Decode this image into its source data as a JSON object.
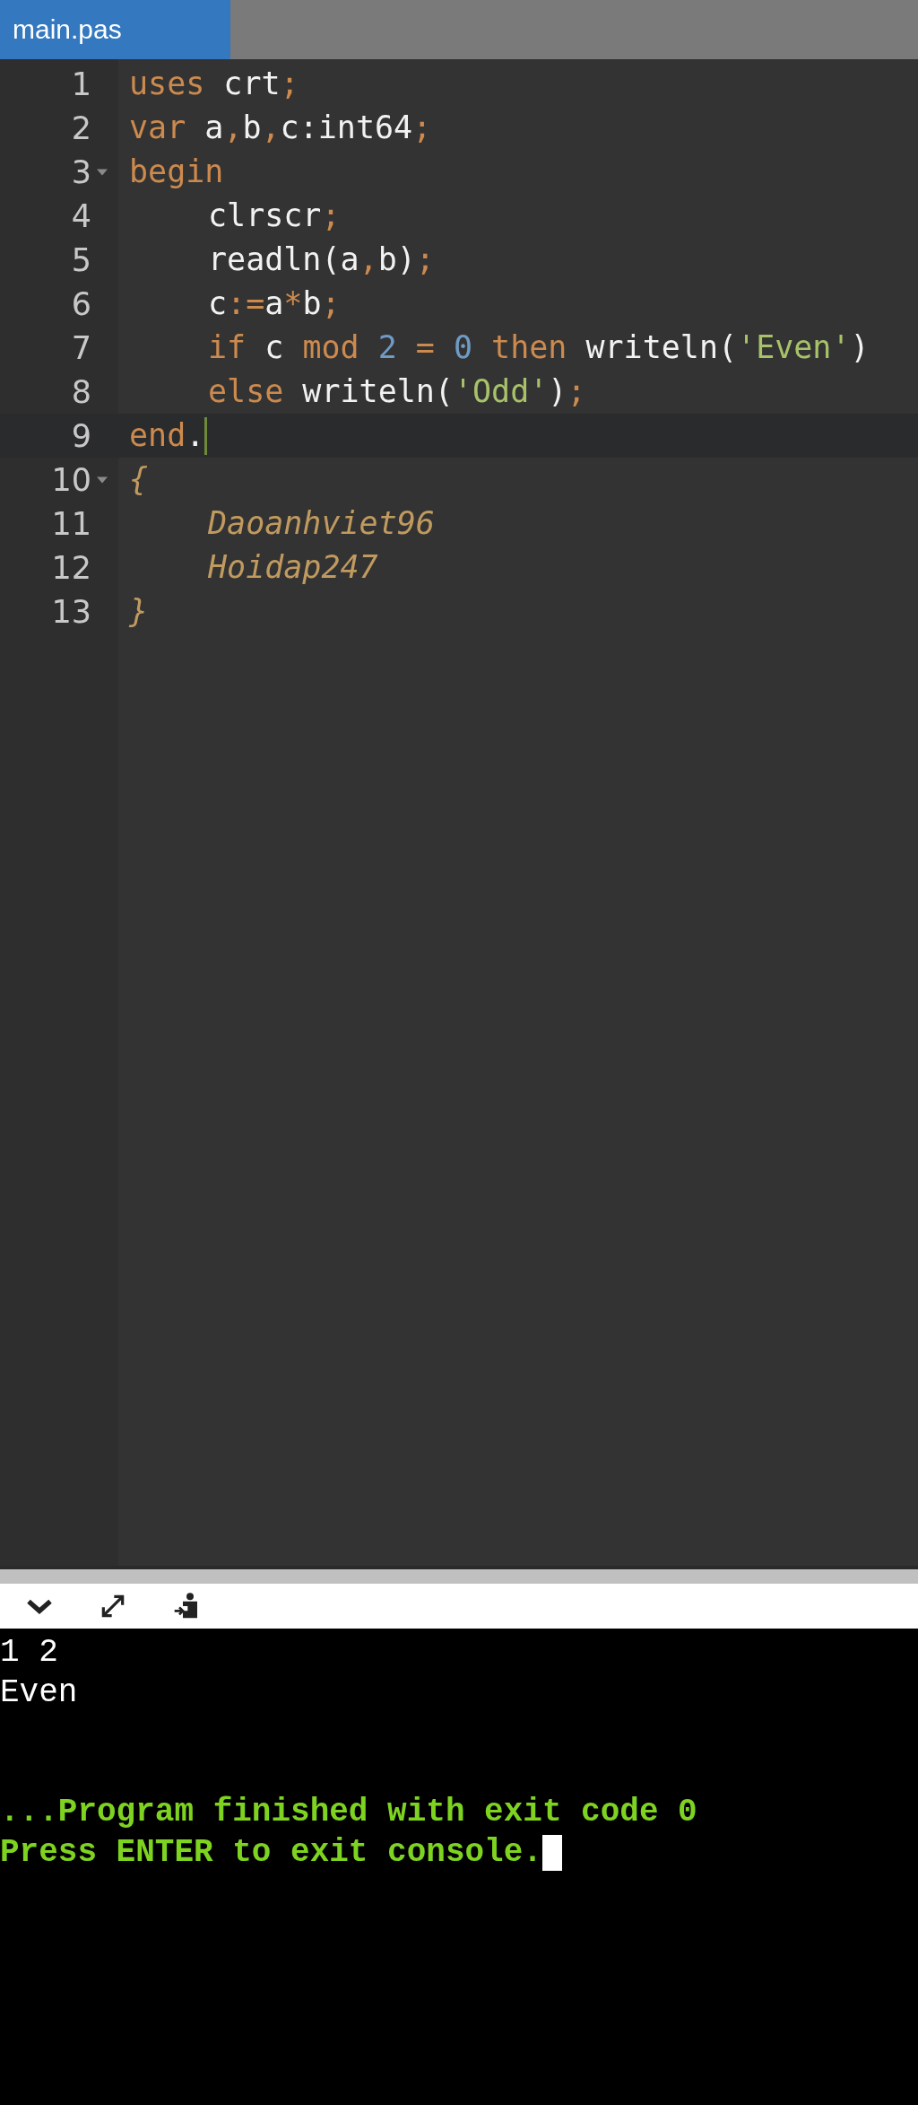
{
  "tabs": [
    {
      "label": "main.pas",
      "selected": true
    }
  ],
  "editor": {
    "lines": [
      {
        "number": "1",
        "foldable": false,
        "active": false,
        "tokens": [
          {
            "text": "uses",
            "kind": "keyword"
          },
          {
            "text": " crt",
            "kind": "ident"
          },
          {
            "text": ";",
            "kind": "punct"
          }
        ]
      },
      {
        "number": "2",
        "foldable": false,
        "active": false,
        "tokens": [
          {
            "text": "var",
            "kind": "keyword"
          },
          {
            "text": " a",
            "kind": "ident"
          },
          {
            "text": ",",
            "kind": "punct"
          },
          {
            "text": "b",
            "kind": "ident"
          },
          {
            "text": ",",
            "kind": "punct"
          },
          {
            "text": "c:int64",
            "kind": "ident"
          },
          {
            "text": ";",
            "kind": "punct"
          }
        ]
      },
      {
        "number": "3",
        "foldable": true,
        "active": false,
        "tokens": [
          {
            "text": "begin",
            "kind": "keyword"
          }
        ],
        "children": [
          {
            "number": "4",
            "foldable": false,
            "active": false,
            "tokens": [
              {
                "text": "clrscr",
                "kind": "ident"
              },
              {
                "text": ";",
                "kind": "punct"
              }
            ]
          },
          {
            "number": "5",
            "foldable": false,
            "active": false,
            "tokens": [
              {
                "text": "readln(a",
                "kind": "ident"
              },
              {
                "text": ",",
                "kind": "punct"
              },
              {
                "text": "b)",
                "kind": "ident"
              },
              {
                "text": ";",
                "kind": "punct"
              }
            ]
          },
          {
            "number": "6",
            "foldable": false,
            "active": false,
            "tokens": [
              {
                "text": "c",
                "kind": "ident"
              },
              {
                "text": ":=",
                "kind": "punct"
              },
              {
                "text": "a",
                "kind": "ident"
              },
              {
                "text": "*",
                "kind": "punct"
              },
              {
                "text": "b",
                "kind": "ident"
              },
              {
                "text": ";",
                "kind": "punct"
              }
            ]
          },
          {
            "number": "7",
            "foldable": false,
            "active": false,
            "tokens": [
              {
                "text": "if",
                "kind": "keyword"
              },
              {
                "text": " c ",
                "kind": "ident"
              },
              {
                "text": "mod",
                "kind": "keyword"
              },
              {
                "text": " 2 ",
                "kind": "number"
              },
              {
                "text": "=",
                "kind": "punct"
              },
              {
                "text": " 0 ",
                "kind": "number"
              },
              {
                "text": "then",
                "kind": "keyword"
              },
              {
                "text": " writeln(",
                "kind": "ident"
              },
              {
                "text": "'Even'",
                "kind": "string"
              },
              {
                "text": ")",
                "kind": "ident"
              }
            ]
          },
          {
            "number": "8",
            "foldable": false,
            "active": false,
            "tokens": [
              {
                "text": "else",
                "kind": "keyword"
              },
              {
                "text": " writeln(",
                "kind": "ident"
              },
              {
                "text": "'Odd'",
                "kind": "string"
              },
              {
                "text": ")",
                "kind": "ident"
              },
              {
                "text": ";",
                "kind": "punct"
              }
            ]
          }
        ]
      },
      {
        "number": "9",
        "foldable": false,
        "active": true,
        "tokens": [
          {
            "text": "end",
            "kind": "keyword"
          },
          {
            "text": ".",
            "kind": "ident"
          }
        ]
      },
      {
        "number": "10",
        "foldable": true,
        "active": false,
        "tokens": [
          {
            "text": "{",
            "kind": "comment"
          }
        ],
        "children": [
          {
            "number": "11",
            "foldable": false,
            "active": false,
            "tokens": [
              {
                "text": "Daoanhviet96",
                "kind": "comment"
              }
            ]
          },
          {
            "number": "12",
            "foldable": false,
            "active": false,
            "tokens": [
              {
                "text": "Hoidap247",
                "kind": "comment"
              }
            ]
          }
        ]
      },
      {
        "number": "13",
        "foldable": false,
        "active": false,
        "tokens": [
          {
            "text": "}",
            "kind": "comment"
          }
        ]
      }
    ]
  },
  "console": {
    "output": [
      "1 2",
      "Even"
    ],
    "messages": [
      "...Program finished with exit code 0",
      "Press ENTER to exit console."
    ],
    "cursor": true
  }
}
